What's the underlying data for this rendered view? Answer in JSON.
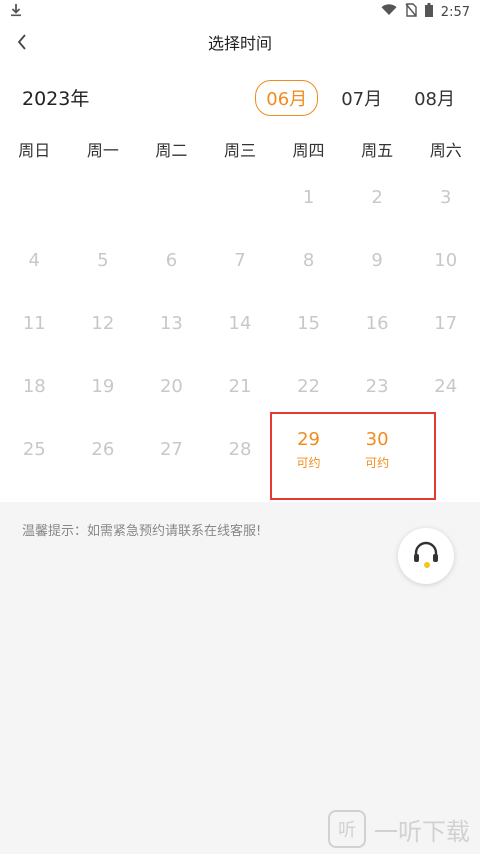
{
  "status_bar": {
    "time": "2:57"
  },
  "nav": {
    "title": "选择时间"
  },
  "calendar": {
    "year": "2023年",
    "months": [
      "06月",
      "07月",
      "08月"
    ],
    "active_month": "06月",
    "weekdays": [
      "周日",
      "周一",
      "周二",
      "周三",
      "周四",
      "周五",
      "周六"
    ],
    "days": [
      {
        "n": "",
        "a": false
      },
      {
        "n": "",
        "a": false
      },
      {
        "n": "",
        "a": false
      },
      {
        "n": "",
        "a": false
      },
      {
        "n": "1",
        "a": false
      },
      {
        "n": "2",
        "a": false
      },
      {
        "n": "3",
        "a": false
      },
      {
        "n": "4",
        "a": false
      },
      {
        "n": "5",
        "a": false
      },
      {
        "n": "6",
        "a": false
      },
      {
        "n": "7",
        "a": false
      },
      {
        "n": "8",
        "a": false
      },
      {
        "n": "9",
        "a": false
      },
      {
        "n": "10",
        "a": false
      },
      {
        "n": "11",
        "a": false
      },
      {
        "n": "12",
        "a": false
      },
      {
        "n": "13",
        "a": false
      },
      {
        "n": "14",
        "a": false
      },
      {
        "n": "15",
        "a": false
      },
      {
        "n": "16",
        "a": false
      },
      {
        "n": "17",
        "a": false
      },
      {
        "n": "18",
        "a": false
      },
      {
        "n": "19",
        "a": false
      },
      {
        "n": "20",
        "a": false
      },
      {
        "n": "21",
        "a": false
      },
      {
        "n": "22",
        "a": false
      },
      {
        "n": "23",
        "a": false
      },
      {
        "n": "24",
        "a": false
      },
      {
        "n": "25",
        "a": false
      },
      {
        "n": "26",
        "a": false
      },
      {
        "n": "27",
        "a": false
      },
      {
        "n": "28",
        "a": false
      },
      {
        "n": "29",
        "a": true,
        "s": "可约"
      },
      {
        "n": "30",
        "a": true,
        "s": "可约"
      },
      {
        "n": "",
        "a": false
      }
    ]
  },
  "tip": {
    "text": "温馨提示：如需紧急预约请联系在线客服!"
  },
  "watermark": {
    "text": "一听下载"
  },
  "colors": {
    "accent": "#f08c1e",
    "highlight": "#e53935"
  },
  "icons": [
    "download-icon",
    "wifi-icon",
    "no-sim-icon",
    "battery-icon",
    "back-arrow-icon",
    "headset-icon"
  ]
}
